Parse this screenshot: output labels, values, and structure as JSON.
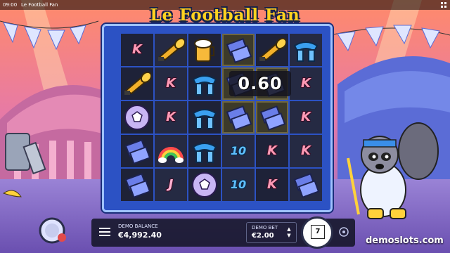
{
  "status_bar": {
    "time": "09:00",
    "app_name": "Le Football Fan"
  },
  "game": {
    "title": "Le Football Fan"
  },
  "colors": {
    "frame": "#2c52c4",
    "title": "#ffd21f",
    "win_bg": "#14141e"
  },
  "grid": {
    "columns": 6,
    "rows": 5,
    "cells": [
      {
        "row": 0,
        "col": 0,
        "symbol": "K",
        "text": "K",
        "highlight": false
      },
      {
        "row": 0,
        "col": 1,
        "symbol": "vuvuzela",
        "text": "",
        "highlight": false
      },
      {
        "row": 0,
        "col": 2,
        "symbol": "beer",
        "text": "",
        "highlight": false
      },
      {
        "row": 0,
        "col": 3,
        "symbol": "tickets",
        "text": "",
        "highlight": true
      },
      {
        "row": 0,
        "col": 4,
        "symbol": "vuvuzela",
        "text": "",
        "highlight": false
      },
      {
        "row": 0,
        "col": 5,
        "symbol": "scarf",
        "text": "",
        "highlight": false
      },
      {
        "row": 1,
        "col": 0,
        "symbol": "vuvuzela",
        "text": "",
        "highlight": false
      },
      {
        "row": 1,
        "col": 1,
        "symbol": "K",
        "text": "K",
        "highlight": false
      },
      {
        "row": 1,
        "col": 2,
        "symbol": "scarf",
        "text": "",
        "highlight": false
      },
      {
        "row": 1,
        "col": 3,
        "symbol": "tickets",
        "text": "",
        "highlight": true
      },
      {
        "row": 1,
        "col": 4,
        "symbol": "tickets",
        "text": "",
        "highlight": true
      },
      {
        "row": 1,
        "col": 5,
        "symbol": "K",
        "text": "K",
        "highlight": false
      },
      {
        "row": 2,
        "col": 0,
        "symbol": "ball",
        "text": "",
        "highlight": false
      },
      {
        "row": 2,
        "col": 1,
        "symbol": "K",
        "text": "K",
        "highlight": false
      },
      {
        "row": 2,
        "col": 2,
        "symbol": "scarf",
        "text": "",
        "highlight": false
      },
      {
        "row": 2,
        "col": 3,
        "symbol": "tickets",
        "text": "",
        "highlight": true
      },
      {
        "row": 2,
        "col": 4,
        "symbol": "tickets",
        "text": "",
        "highlight": true
      },
      {
        "row": 2,
        "col": 5,
        "symbol": "K",
        "text": "K",
        "highlight": false
      },
      {
        "row": 3,
        "col": 0,
        "symbol": "tickets",
        "text": "",
        "highlight": false
      },
      {
        "row": 3,
        "col": 1,
        "symbol": "rainbow",
        "text": "",
        "highlight": false
      },
      {
        "row": 3,
        "col": 2,
        "symbol": "scarf",
        "text": "",
        "highlight": false
      },
      {
        "row": 3,
        "col": 3,
        "symbol": "10",
        "text": "10",
        "highlight": false
      },
      {
        "row": 3,
        "col": 4,
        "symbol": "K",
        "text": "K",
        "highlight": false
      },
      {
        "row": 3,
        "col": 5,
        "symbol": "K",
        "text": "K",
        "highlight": false
      },
      {
        "row": 4,
        "col": 0,
        "symbol": "tickets",
        "text": "",
        "highlight": false
      },
      {
        "row": 4,
        "col": 1,
        "symbol": "J",
        "text": "J",
        "highlight": false
      },
      {
        "row": 4,
        "col": 2,
        "symbol": "ball",
        "text": "",
        "highlight": false
      },
      {
        "row": 4,
        "col": 3,
        "symbol": "10",
        "text": "10",
        "highlight": false
      },
      {
        "row": 4,
        "col": 4,
        "symbol": "K",
        "text": "K",
        "highlight": false
      },
      {
        "row": 4,
        "col": 5,
        "symbol": "tickets",
        "text": "",
        "highlight": false
      }
    ]
  },
  "win": {
    "amount": "0.60"
  },
  "controls": {
    "balance_label": "DEMO BALANCE",
    "balance_value": "€4,992.40",
    "bet_label": "DEMO BET",
    "bet_value": "€2.00",
    "spin_count": "7"
  },
  "watermark": "demoslots.com"
}
